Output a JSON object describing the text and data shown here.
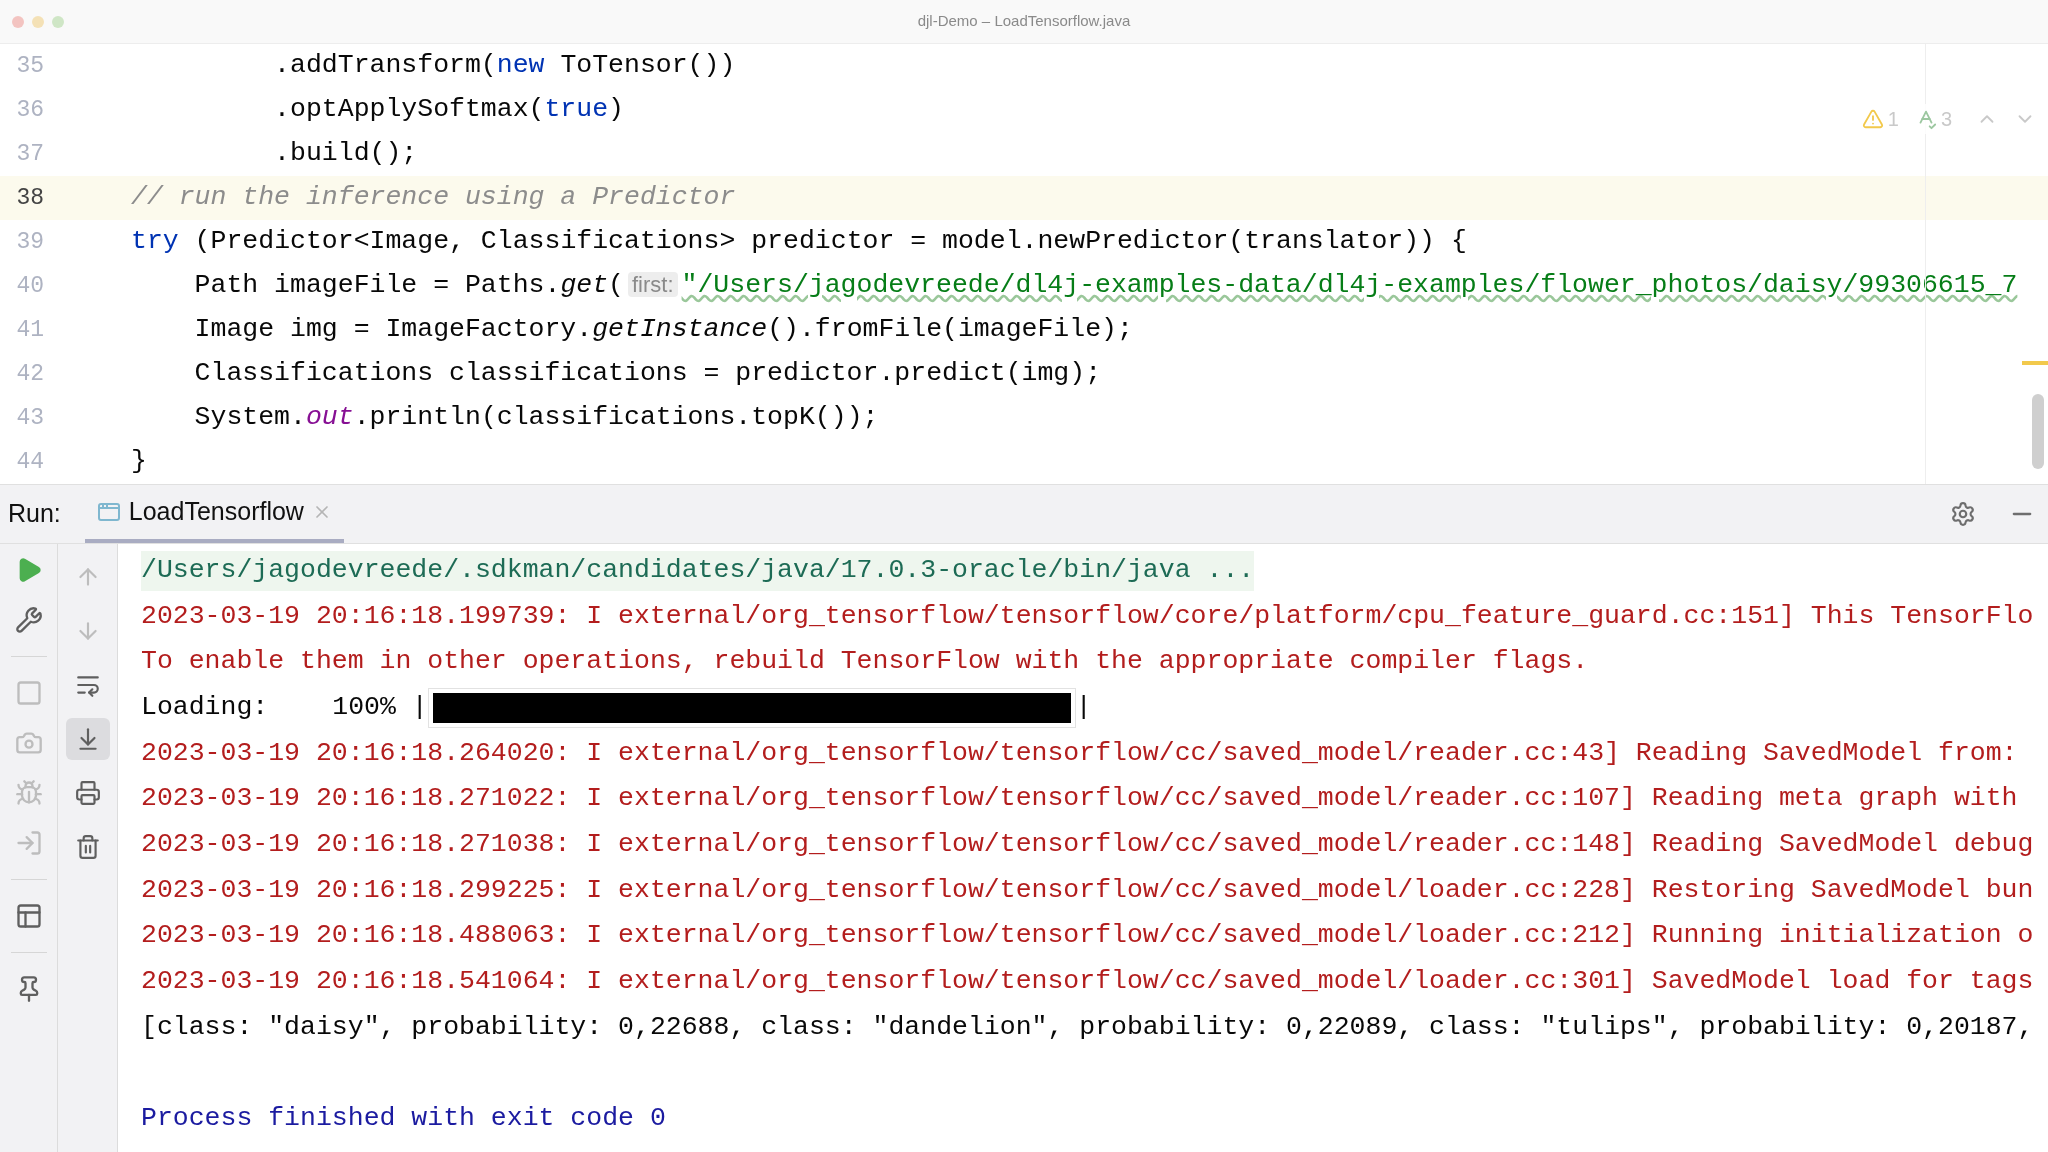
{
  "window": {
    "title": "djl-Demo – LoadTensorflow.java"
  },
  "editor": {
    "inspections": [
      {
        "kind": "warning",
        "count": "1"
      },
      {
        "kind": "typo",
        "count": "3"
      }
    ],
    "lines": [
      {
        "number": "35",
        "current": false,
        "tokens": [
          {
            "kind": "plain",
            "text": "         .addTransform("
          },
          {
            "kind": "keyword",
            "text": "new"
          },
          {
            "kind": "plain",
            "text": " ToTensor())"
          }
        ]
      },
      {
        "number": "36",
        "current": false,
        "tokens": [
          {
            "kind": "plain",
            "text": "         .optApplySoftmax("
          },
          {
            "kind": "keyword",
            "text": "true"
          },
          {
            "kind": "plain",
            "text": ")"
          }
        ]
      },
      {
        "number": "37",
        "current": false,
        "tokens": [
          {
            "kind": "plain",
            "text": "         .build();"
          }
        ]
      },
      {
        "number": "38",
        "current": true,
        "tokens": [
          {
            "kind": "comment",
            "text": "// run the inference using a Predictor"
          }
        ]
      },
      {
        "number": "39",
        "current": false,
        "tokens": [
          {
            "kind": "keyword",
            "text": "try"
          },
          {
            "kind": "plain",
            "text": " (Predictor<Image, Classifications> predictor = model.newPredictor(translator)) {"
          }
        ]
      },
      {
        "number": "40",
        "current": false,
        "tokens": [
          {
            "kind": "plain",
            "text": "    Path imageFile = Paths."
          },
          {
            "kind": "static_method",
            "text": "get"
          },
          {
            "kind": "plain",
            "text": "("
          },
          {
            "kind": "hint",
            "text": "first:"
          },
          {
            "kind": "string",
            "text": "\"/Users/jagodevreede/dl4j-examples-data/dl4j-examples/flower_photos/daisy/99306615_7"
          }
        ]
      },
      {
        "number": "41",
        "current": false,
        "tokens": [
          {
            "kind": "plain",
            "text": "    Image img = ImageFactory."
          },
          {
            "kind": "static_method",
            "text": "getInstance"
          },
          {
            "kind": "plain",
            "text": "().fromFile(imageFile);"
          }
        ]
      },
      {
        "number": "42",
        "current": false,
        "tokens": [
          {
            "kind": "plain",
            "text": "    Classifications classifications = predictor.predict(img);"
          }
        ]
      },
      {
        "number": "43",
        "current": false,
        "tokens": [
          {
            "kind": "plain",
            "text": "    System."
          },
          {
            "kind": "static_field",
            "text": "out"
          },
          {
            "kind": "plain",
            "text": ".println(classifications.topK());"
          }
        ]
      },
      {
        "number": "44",
        "current": false,
        "tokens": [
          {
            "kind": "plain",
            "text": "}"
          }
        ]
      }
    ]
  },
  "run_panel": {
    "label": "Run:",
    "tabs": [
      {
        "label": "LoadTensorflow",
        "selected": true
      }
    ],
    "left_toolbar": [
      {
        "kind": "rerun",
        "disabled": false
      },
      {
        "kind": "edit_config",
        "disabled": false
      },
      {
        "kind": "separator"
      },
      {
        "kind": "stop",
        "disabled": true
      },
      {
        "kind": "dump",
        "disabled": true
      },
      {
        "kind": "debug",
        "disabled": true
      },
      {
        "kind": "exit",
        "disabled": true
      },
      {
        "kind": "separator"
      },
      {
        "kind": "layout",
        "disabled": false
      },
      {
        "kind": "separator"
      },
      {
        "kind": "pin",
        "disabled": false
      }
    ],
    "console_toolbar": [
      {
        "kind": "up",
        "disabled": true,
        "on": false
      },
      {
        "kind": "down",
        "disabled": true,
        "on": false
      },
      {
        "kind": "wrap",
        "disabled": false,
        "on": false
      },
      {
        "kind": "scroll_end",
        "disabled": false,
        "on": true
      },
      {
        "kind": "print",
        "disabled": false,
        "on": false
      },
      {
        "kind": "trash",
        "disabled": false,
        "on": false
      }
    ],
    "console": [
      {
        "kind": "command",
        "text": "/Users/jagodevreede/.sdkman/candidates/java/17.0.3-oracle/bin/java ..."
      },
      {
        "kind": "stderr",
        "text": "2023-03-19 20:16:18.199739: I external/org_tensorflow/tensorflow/core/platform/cpu_feature_guard.cc:151] This TensorFlo"
      },
      {
        "kind": "stderr",
        "text": "To enable them in other operations, rebuild TensorFlow with the appropriate compiler flags."
      },
      {
        "kind": "progress",
        "label": "Loading:",
        "reading": "100%",
        "bar_start": "|",
        "bar_end": "|",
        "level": 1
      },
      {
        "kind": "stderr",
        "text": "2023-03-19 20:16:18.264020: I external/org_tensorflow/tensorflow/cc/saved_model/reader.cc:43] Reading SavedModel from:"
      },
      {
        "kind": "stderr",
        "text": "2023-03-19 20:16:18.271022: I external/org_tensorflow/tensorflow/cc/saved_model/reader.cc:107] Reading meta graph with"
      },
      {
        "kind": "stderr",
        "text": "2023-03-19 20:16:18.271038: I external/org_tensorflow/tensorflow/cc/saved_model/reader.cc:148] Reading SavedModel debug"
      },
      {
        "kind": "stderr",
        "text": "2023-03-19 20:16:18.299225: I external/org_tensorflow/tensorflow/cc/saved_model/loader.cc:228] Restoring SavedModel bun"
      },
      {
        "kind": "stderr",
        "text": "2023-03-19 20:16:18.488063: I external/org_tensorflow/tensorflow/cc/saved_model/loader.cc:212] Running initialization o"
      },
      {
        "kind": "stderr",
        "text": "2023-03-19 20:16:18.541064: I external/org_tensorflow/tensorflow/cc/saved_model/loader.cc:301] SavedModel load for tags"
      },
      {
        "kind": "stdout",
        "text": "[class: \"daisy\", probability: 0,22688, class: \"dandelion\", probability: 0,22089, class: \"tulips\", probability: 0,20187,"
      },
      {
        "kind": "blank"
      },
      {
        "kind": "system",
        "text": "Process finished with exit code 0"
      }
    ]
  }
}
